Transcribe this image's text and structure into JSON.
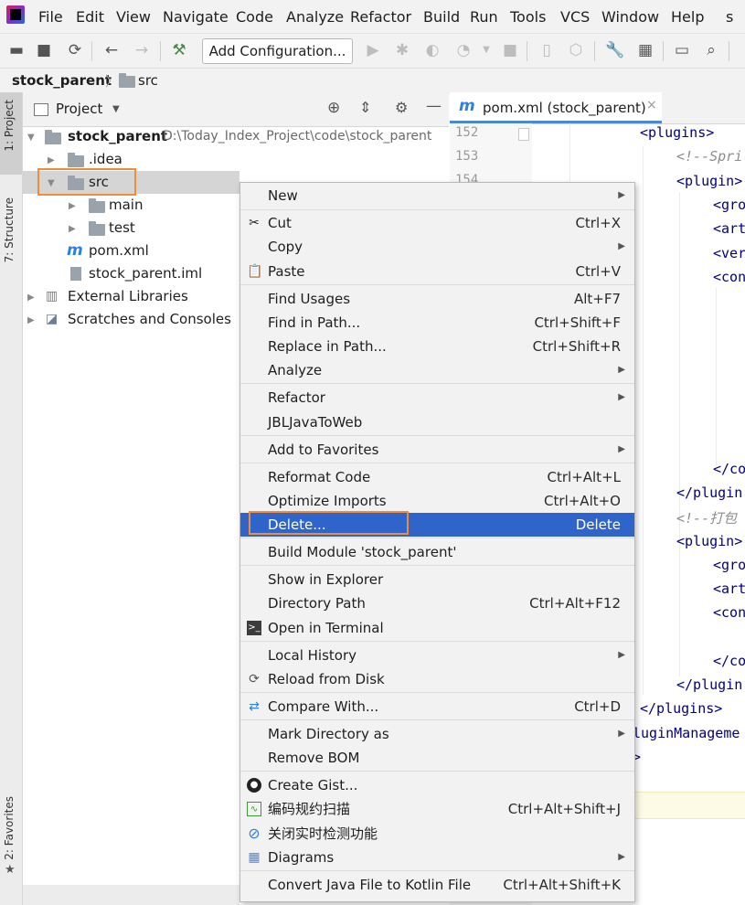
{
  "menubar": {
    "items": [
      "File",
      "Edit",
      "View",
      "Navigate",
      "Code",
      "Analyze",
      "Refactor",
      "Build",
      "Run",
      "Tools",
      "VCS",
      "Window",
      "Help"
    ],
    "trailing": "s"
  },
  "toolbar": {
    "add_configuration": "Add Configuration..."
  },
  "breadcrumb": {
    "project": "stock_parent",
    "folder": "src"
  },
  "sidebar": {
    "project_tab": "1: Project",
    "structure_tab": "7: Structure",
    "favorites_tab": "2: Favorites"
  },
  "project_panel": {
    "title": "Project",
    "root": {
      "name": "stock_parent",
      "path": "D:\\Today_Index_Project\\code\\stock_parent"
    },
    "items": [
      ".idea",
      "src",
      "main",
      "test",
      "pom.xml",
      "stock_parent.iml",
      "External Libraries",
      "Scratches and Consoles"
    ]
  },
  "editor": {
    "tab": "pom.xml (stock_parent)",
    "line_numbers": [
      "152",
      "153",
      "154"
    ],
    "code": {
      "plugins_open": "<plugins>",
      "comment1": "<!--Spri",
      "plugin1": "<plugin>",
      "gro1": "<gro",
      "art1": "<art",
      "ver1": "<ver",
      "con1": "<con",
      "con_close1": "</co",
      "plugin_close1": "</plugin",
      "comment2": "<!--打包",
      "plugin2": "<plugin>",
      "gro2": "<gro",
      "art2": "<art",
      "con2": "<con",
      "con_close2": "</co",
      "plugin_close2": "</plugin",
      "plugins_close": "</plugins>",
      "plugin_mgmt": "luginManageme",
      "gt": ">"
    }
  },
  "context_menu": {
    "items": [
      {
        "label": "New",
        "shortcut": "",
        "submenu": true
      },
      {
        "label": "Cut",
        "shortcut": "Ctrl+X"
      },
      {
        "label": "Copy",
        "shortcut": "",
        "submenu": true
      },
      {
        "label": "Paste",
        "shortcut": "Ctrl+V"
      },
      {
        "label": "Find Usages",
        "shortcut": "Alt+F7"
      },
      {
        "label": "Find in Path...",
        "shortcut": "Ctrl+Shift+F"
      },
      {
        "label": "Replace in Path...",
        "shortcut": "Ctrl+Shift+R"
      },
      {
        "label": "Analyze",
        "shortcut": "",
        "submenu": true
      },
      {
        "label": "Refactor",
        "shortcut": "",
        "submenu": true
      },
      {
        "label": "JBLJavaToWeb",
        "shortcut": ""
      },
      {
        "label": "Add to Favorites",
        "shortcut": "",
        "submenu": true
      },
      {
        "label": "Reformat Code",
        "shortcut": "Ctrl+Alt+L"
      },
      {
        "label": "Optimize Imports",
        "shortcut": "Ctrl+Alt+O"
      },
      {
        "label": "Delete...",
        "shortcut": "Delete"
      },
      {
        "label": "Build Module 'stock_parent'",
        "shortcut": ""
      },
      {
        "label": "Show in Explorer",
        "shortcut": ""
      },
      {
        "label": "Directory Path",
        "shortcut": "Ctrl+Alt+F12"
      },
      {
        "label": "Open in Terminal",
        "shortcut": ""
      },
      {
        "label": "Local History",
        "shortcut": "",
        "submenu": true
      },
      {
        "label": "Reload from Disk",
        "shortcut": ""
      },
      {
        "label": "Compare With...",
        "shortcut": "Ctrl+D"
      },
      {
        "label": "Mark Directory as",
        "shortcut": "",
        "submenu": true
      },
      {
        "label": "Remove BOM",
        "shortcut": ""
      },
      {
        "label": "Create Gist...",
        "shortcut": ""
      },
      {
        "label": "编码规约扫描",
        "shortcut": "Ctrl+Alt+Shift+J"
      },
      {
        "label": "关闭实时检测功能",
        "shortcut": ""
      },
      {
        "label": "Diagrams",
        "shortcut": "",
        "submenu": true
      },
      {
        "label": "Convert Java File to Kotlin File",
        "shortcut": "Ctrl+Alt+Shift+K"
      }
    ]
  },
  "colors": {
    "selection": "#2f65ca",
    "highlight_border": "#f08c3a",
    "tag": "#000080",
    "comment": "#8c8c8c"
  }
}
